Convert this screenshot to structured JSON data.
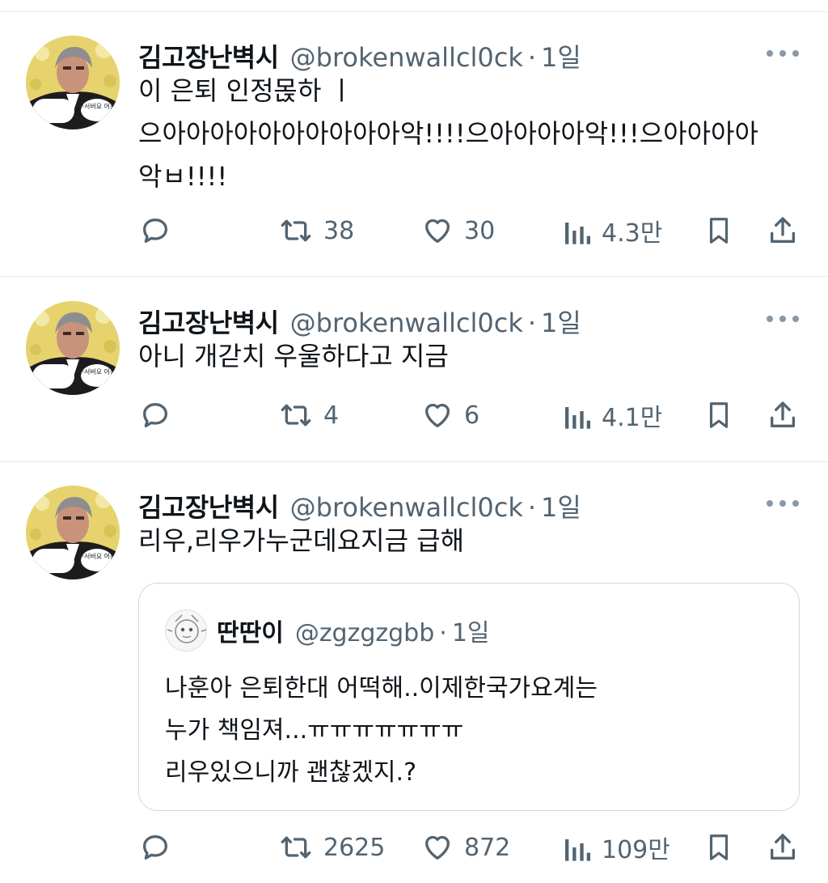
{
  "tweets": [
    {
      "author": {
        "name": "김고장난벽시",
        "handle": "@brokenwallcl0ck"
      },
      "time": "1일",
      "avatar_caption": "무서버요 어흥",
      "lines": [
        "이 은퇴 인정몭하 ㅣ",
        "으아아아아아아아아아아악!!!!으아아아아악!!!으아아아아",
        "악ㅂ!!!!"
      ],
      "stats": {
        "replies": "",
        "retweets": "38",
        "likes": "30",
        "views": "4.3만"
      }
    },
    {
      "author": {
        "name": "김고장난벽시",
        "handle": "@brokenwallcl0ck"
      },
      "time": "1일",
      "avatar_caption": "무서버요 어흥",
      "lines": [
        "아니 개갇치 우울하다고 지금"
      ],
      "stats": {
        "replies": "",
        "retweets": "4",
        "likes": "6",
        "views": "4.1만"
      }
    },
    {
      "author": {
        "name": "김고장난벽시",
        "handle": "@brokenwallcl0ck"
      },
      "time": "1일",
      "avatar_caption": "무서버요 어흥",
      "lines": [
        "리우,리우가누군데요지금 급해"
      ],
      "quote": {
        "author": {
          "name": "딴딴이",
          "handle": "@zgzgzgbb"
        },
        "time": "1일",
        "lines": [
          "나훈아 은퇴한대 어떡해..이제한국가요계는",
          "누가 책임져...ㅠㅠㅠㅠㅠㅠㅠ",
          "리우있으니까 괜찮겠지.?"
        ]
      },
      "stats": {
        "replies": "",
        "retweets": "2625",
        "likes": "872",
        "views": "109만"
      }
    }
  ],
  "icons": {
    "reply": "reply-icon",
    "retweet": "retweet-icon",
    "like": "heart-icon",
    "views": "views-chart-icon",
    "bookmark": "bookmark-icon",
    "share": "share-icon",
    "more": "more-dots-icon"
  },
  "colors": {
    "text": "#0f1419",
    "secondary": "#536471",
    "border": "#cfd9de",
    "divider": "#e6e9eb"
  }
}
